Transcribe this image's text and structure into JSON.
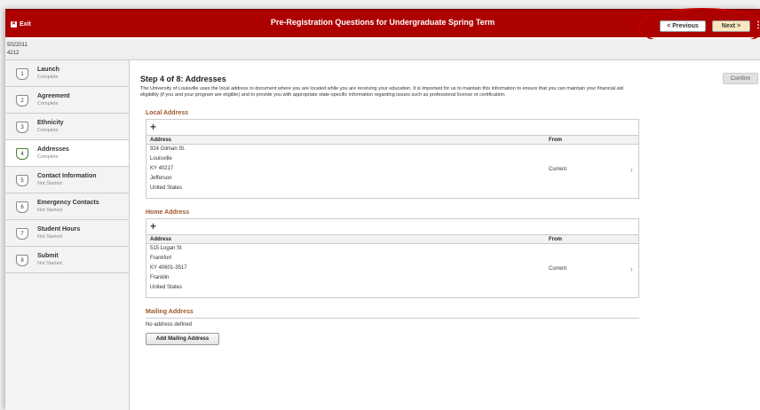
{
  "header": {
    "exit_label": "Exit",
    "title": "Pre-Registration Questions for Undergraduate Spring Term",
    "previous_label": "< Previous",
    "next_label": "Next >",
    "menu_glyph": "⋮",
    "bar_color": "#ad0000"
  },
  "id_bar": {
    "line1": "5022011",
    "line2": "4212"
  },
  "sidebar": {
    "steps": [
      {
        "num": "1",
        "name": "Launch",
        "status": "Complete"
      },
      {
        "num": "2",
        "name": "Agreement",
        "status": "Complete"
      },
      {
        "num": "3",
        "name": "Ethnicity",
        "status": "Complete"
      },
      {
        "num": "4",
        "name": "Addresses",
        "status": "Complete"
      },
      {
        "num": "5",
        "name": "Contact Information",
        "status": "Not Started"
      },
      {
        "num": "6",
        "name": "Emergency Contacts",
        "status": "Not Started"
      },
      {
        "num": "7",
        "name": "Student Hours",
        "status": "Not Started"
      },
      {
        "num": "8",
        "name": "Submit",
        "status": "Not Started"
      }
    ]
  },
  "main": {
    "heading": "Step 4 of 8: Addresses",
    "intro": "The University of Louisville uses the local address to document where you are located while you are receiving your education. It is important for us to maintain this information to ensure that you can maintain your financial aid eligibility (if you and your program are eligible) and to provide you with appropriate state-specific information regarding issues such as professional license or certification.",
    "confirm_label": "Confirm",
    "local": {
      "title": "Local Address",
      "col_address": "Address",
      "col_from": "From",
      "lines": [
        "924 Gilman St.",
        "Louisville",
        "KY 40217",
        "Jefferson",
        "United States"
      ],
      "from": "Current"
    },
    "home": {
      "title": "Home Address",
      "col_address": "Address",
      "col_from": "From",
      "lines": [
        "515 Logan St",
        "Frankfort",
        "KY 40601-3517",
        "Franklin",
        "United States"
      ],
      "from": "Current"
    },
    "mailing": {
      "title": "Mailing Address",
      "empty_text": "No address defined",
      "add_label": "Add Mailing Address"
    }
  }
}
